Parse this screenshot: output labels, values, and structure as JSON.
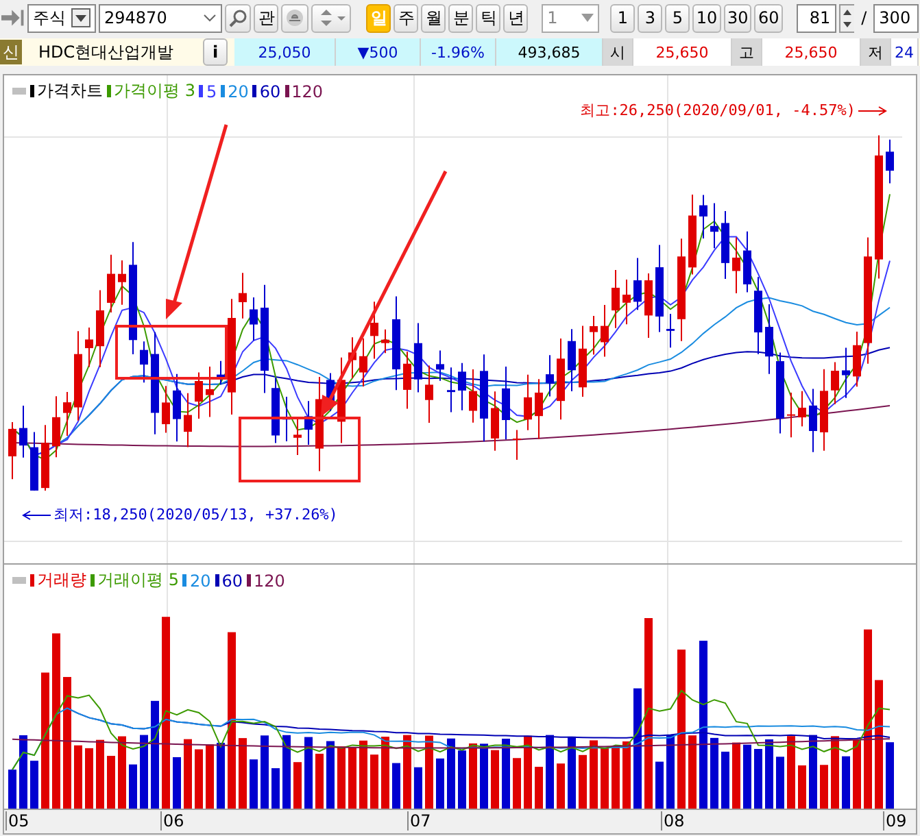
{
  "toolbar": {
    "market": "주식",
    "code": "294870",
    "watch_button": "관",
    "periods": [
      {
        "label": "일",
        "selected": true
      },
      {
        "label": "주",
        "selected": false
      },
      {
        "label": "월",
        "selected": false
      },
      {
        "label": "분",
        "selected": false
      },
      {
        "label": "틱",
        "selected": false
      },
      {
        "label": "년",
        "selected": false
      }
    ],
    "interval_select": "1",
    "intervals": [
      "1",
      "3",
      "5",
      "10",
      "30",
      "60"
    ],
    "count": "81",
    "separator": "/",
    "total": "300"
  },
  "quote": {
    "badge": "신",
    "name": "HDC현대산업개발",
    "info_button": "i",
    "price": "25,050",
    "change": "▼500",
    "change_pct": "-1.96%",
    "volume": "493,685",
    "fields": [
      {
        "label": "시",
        "value": "25,650"
      },
      {
        "label": "고",
        "value": "25,650"
      },
      {
        "label": "저",
        "value": "24"
      }
    ]
  },
  "price_chart": {
    "legend": [
      {
        "label": "가격차트",
        "color": "#000000"
      },
      {
        "label": "가격이평 3",
        "color": "#3c9a00"
      },
      {
        "label": "5",
        "color": "#3b3bff"
      },
      {
        "label": "20",
        "color": "#1a8ce0"
      },
      {
        "label": "60",
        "color": "#0000b4"
      },
      {
        "label": "120",
        "color": "#7a1450"
      }
    ],
    "high_note": "최고:26,250(2020/09/01, -4.57%)",
    "low_note": "최저:18,250(2020/05/13, +37.26%)"
  },
  "volume_chart": {
    "legend": [
      {
        "label": "거래량",
        "color": "#e00000"
      },
      {
        "label": "거래이평 5",
        "color": "#3c9a00"
      },
      {
        "label": "20",
        "color": "#1a8ce0"
      },
      {
        "label": "60",
        "color": "#0000b4"
      },
      {
        "label": "120",
        "color": "#7a1450"
      }
    ]
  },
  "x_axis": [
    "05",
    "06",
    "07",
    "08",
    "09"
  ]
}
